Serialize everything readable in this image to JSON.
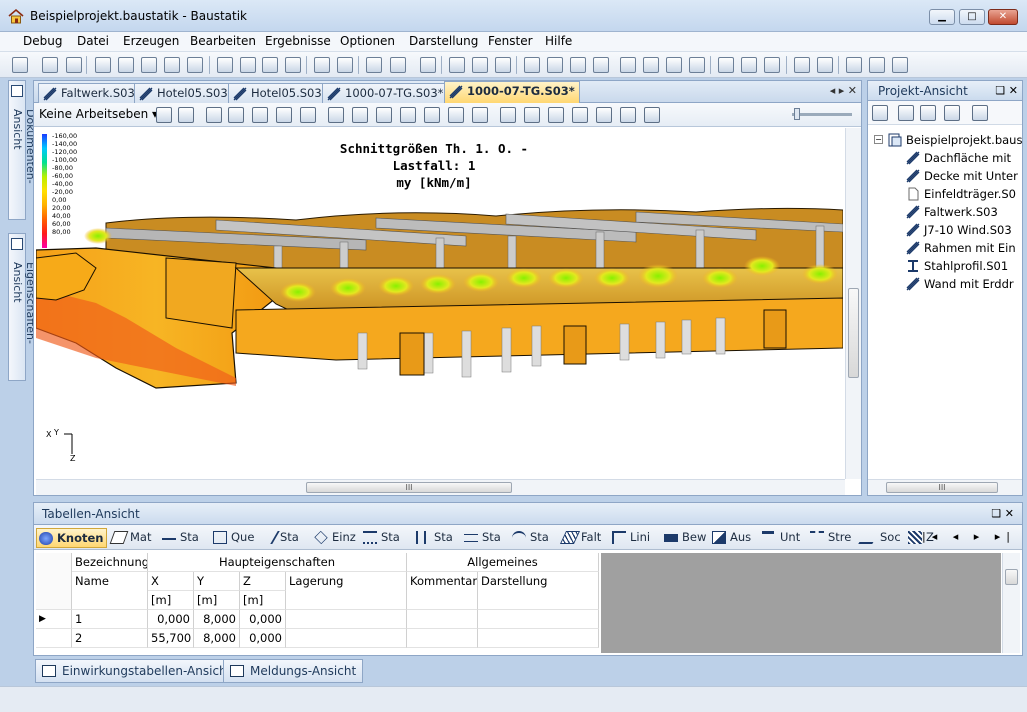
{
  "window": {
    "title": "Beispielprojekt.baustatik - Baustatik",
    "controls": {
      "minimize": "▁",
      "maximize": "□",
      "close": "✕"
    }
  },
  "menu": [
    "Debug",
    "Datei",
    "Erzeugen",
    "Bearbeiten",
    "Ergebnisse",
    "Optionen",
    "Darstellung",
    "Fenster",
    "Hilfe"
  ],
  "left_sidebar": {
    "documents_tab": "Dokumenten-Ansicht",
    "properties_tab": "Eigenschaften-Ansicht"
  },
  "document": {
    "tabs": [
      {
        "label": "Faltwerk.S03",
        "active": false
      },
      {
        "label": "Hotel05.S03",
        "active": false
      },
      {
        "label": "Hotel05.S03",
        "active": false
      },
      {
        "label": "1000-07-TG.S03*",
        "active": false
      },
      {
        "label": "1000-07-TG.S03*",
        "active": true
      }
    ],
    "tab_controls": "◂ ▸  ✕",
    "workplane_select": "Keine Arbeitseben",
    "canvas_title_line1": "Schnittgrößen Th. 1. O. - Lastfall: 1",
    "canvas_title_line2": "my [kNm/m]",
    "legend_values": [
      "-160,00",
      "-140,00",
      "-120,00",
      "-100,00",
      "-80,00",
      "-60,00",
      "-40,00",
      "-20,00",
      "0,00",
      "20,00",
      "40,00",
      "60,00",
      "80,00"
    ],
    "axis_labels": {
      "x": "X",
      "y": "Y",
      "z": "Z"
    },
    "hscroll_grip": "III"
  },
  "project_panel": {
    "title": "Projekt-Ansicht",
    "header_buttons": "❑  ✕",
    "root": "Beispielprojekt.baus",
    "items": [
      {
        "label": "Dachfläche mit",
        "icon": "plate-icon"
      },
      {
        "label": "Decke mit Unter",
        "icon": "plate-icon"
      },
      {
        "label": "Einfeldträger.S0",
        "icon": "document-icon"
      },
      {
        "label": "Faltwerk.S03",
        "icon": "plate-icon"
      },
      {
        "label": "J7-10 Wind.S03",
        "icon": "plate-icon"
      },
      {
        "label": "Rahmen mit Ein",
        "icon": "plate-icon"
      },
      {
        "label": "Stahlprofil.S01",
        "icon": "steel-profile-icon"
      },
      {
        "label": "Wand mit Erddr",
        "icon": "plate-icon"
      }
    ],
    "hscroll_grip": "III"
  },
  "table_panel": {
    "title": "Tabellen-Ansicht",
    "header_buttons": "❑  ✕",
    "tabs": [
      {
        "label": "Knoten",
        "active": true
      },
      {
        "label": "Mat",
        "active": false
      },
      {
        "label": "Sta",
        "active": false
      },
      {
        "label": "Que",
        "active": false
      },
      {
        "label": "Sta",
        "active": false
      },
      {
        "label": "Einz",
        "active": false
      },
      {
        "label": "Sta",
        "active": false
      },
      {
        "label": "Sta",
        "active": false
      },
      {
        "label": "Sta",
        "active": false
      },
      {
        "label": "Sta",
        "active": false
      },
      {
        "label": "Falt",
        "active": false
      },
      {
        "label": "Lini",
        "active": false
      },
      {
        "label": "Bew",
        "active": false
      },
      {
        "label": "Aus",
        "active": false
      },
      {
        "label": "Unt",
        "active": false
      },
      {
        "label": "Stre",
        "active": false
      },
      {
        "label": "Soc",
        "active": false
      },
      {
        "label": "Z",
        "active": false
      }
    ],
    "nav": "|◂ ◂ ▸ ▸|",
    "groups": {
      "bezeichnung": "Bezeichnung",
      "haupteigenschaften": "Haupteigenschaften",
      "allgemeines": "Allgemeines"
    },
    "columns": {
      "name": "Name",
      "x": "X",
      "y": "Y",
      "z": "Z",
      "lagerung": "Lagerung",
      "kommentar": "Kommentar",
      "darstellung": "Darstellung"
    },
    "units": {
      "x": "[m]",
      "y": "[m]",
      "z": "[m]"
    },
    "rows": [
      {
        "name": "1",
        "x": "0,000",
        "y": "8,000",
        "z": "0,000"
      },
      {
        "name": "2",
        "x": "55,700",
        "y": "8,000",
        "z": "0,000"
      }
    ],
    "current_row_marker": "▶"
  },
  "bottom_tabs": [
    "Einwirkungstabellen-Ansicht",
    "Meldungs-Ansicht"
  ]
}
